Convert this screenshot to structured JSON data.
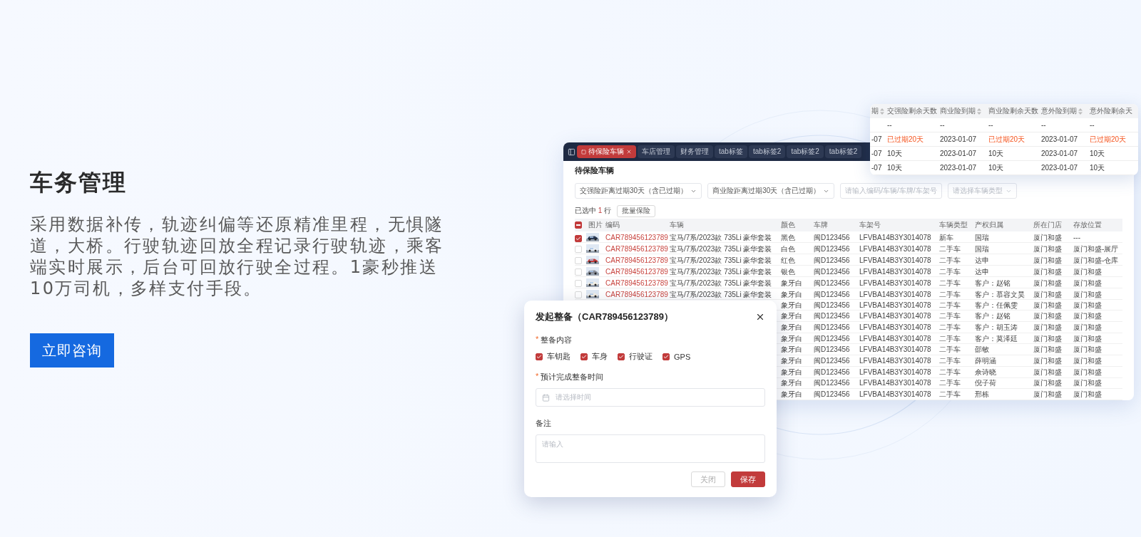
{
  "hero": {
    "title": "车务管理",
    "description": "采用数据补传，轨迹纠偏等还原精准里程，无惧隧道，大桥。行驶轨迹回放全程记录行驶轨迹，乘客端实时展示，后台可回放行驶全过程。1豪秒推送10万司机，多样支付手段。",
    "button": "立即咨询"
  },
  "app": {
    "tabs": [
      {
        "label": "待保险车辆",
        "selected": true
      },
      {
        "label": "车店管理",
        "selected": false
      },
      {
        "label": "财务管理",
        "selected": false
      },
      {
        "label": "tab标签",
        "selected": false
      },
      {
        "label": "tab标签2",
        "selected": false
      },
      {
        "label": "tab标签2",
        "selected": false
      },
      {
        "label": "tab标签2",
        "selected": false
      }
    ],
    "page_title": "待保险车辆",
    "filters": [
      {
        "kind": "select",
        "value": "交强险距离过期30天（含已过期）"
      },
      {
        "kind": "select",
        "value": "商业险距离过期30天（含已过期）"
      },
      {
        "kind": "input",
        "placeholder": "请输入编码/车辆/车牌/车架号"
      },
      {
        "kind": "select",
        "placeholder": "请选择车辆类型"
      }
    ],
    "selection": {
      "prefix": "已选中",
      "count": "1",
      "suffix": "行"
    },
    "batch_button": "批量保险",
    "table": {
      "select_all_partial": true,
      "columns": [
        "图片",
        "编码",
        "车辆",
        "颜色",
        "车牌",
        "车架号",
        "车辆类型",
        "产权归属",
        "所在门店",
        "存放位置"
      ],
      "rows": [
        {
          "checked": true,
          "code": "CAR789456123789",
          "vehicle": "宝马/7系/2023款 735Li 豪华套装",
          "paint": "黑色",
          "plate": "闽D123456",
          "vin": "LFVBA14B3Y3014078",
          "type": "新车",
          "owner": "国瑞",
          "store": "厦门和盛",
          "location": "---"
        },
        {
          "checked": false,
          "code": "CAR789456123789",
          "vehicle": "宝马/7系/2023款 735Li 豪华套装",
          "paint": "白色",
          "plate": "闽D123456",
          "vin": "LFVBA14B3Y3014078",
          "type": "二手车",
          "owner": "国瑞",
          "store": "厦门和盛",
          "location": "厦门和盛-展厅"
        },
        {
          "checked": false,
          "code": "CAR789456123789",
          "vehicle": "宝马/7系/2023款 735Li 豪华套装",
          "paint": "红色",
          "plate": "闽D123456",
          "vin": "LFVBA14B3Y3014078",
          "type": "二手车",
          "owner": "达申",
          "store": "厦门和盛",
          "location": "厦门和盛-仓库"
        },
        {
          "checked": false,
          "code": "CAR789456123789",
          "vehicle": "宝马/7系/2023款 735Li 豪华套装",
          "paint": "银色",
          "plate": "闽D123456",
          "vin": "LFVBA14B3Y3014078",
          "type": "二手车",
          "owner": "达申",
          "store": "厦门和盛",
          "location": "厦门和盛"
        },
        {
          "checked": false,
          "code": "CAR789456123789",
          "vehicle": "宝马/7系/2023款 735Li 豪华套装",
          "paint": "象牙白",
          "plate": "闽D123456",
          "vin": "LFVBA14B3Y3014078",
          "type": "二手车",
          "owner": "客户：赵铭",
          "store": "厦门和盛",
          "location": "厦门和盛"
        },
        {
          "checked": false,
          "code": "CAR789456123789",
          "vehicle": "宝马/7系/2023款 735Li 豪华套装",
          "paint": "象牙白",
          "plate": "闽D123456",
          "vin": "LFVBA14B3Y3014078",
          "type": "二手车",
          "owner": "客户：慕容文昊",
          "store": "厦门和盛",
          "location": "厦门和盛"
        },
        {
          "paint": "象牙白",
          "plate": "闽D123456",
          "vin": "LFVBA14B3Y3014078",
          "type": "二手车",
          "owner": "客户：任佩雯",
          "store": "厦门和盛",
          "location": "厦门和盛"
        },
        {
          "paint": "象牙白",
          "plate": "闽D123456",
          "vin": "LFVBA14B3Y3014078",
          "type": "二手车",
          "owner": "客户：赵铭",
          "store": "厦门和盛",
          "location": "厦门和盛"
        },
        {
          "paint": "象牙白",
          "plate": "闽D123456",
          "vin": "LFVBA14B3Y3014078",
          "type": "二手车",
          "owner": "客户：胡玉涛",
          "store": "厦门和盛",
          "location": "厦门和盛"
        },
        {
          "paint": "象牙白",
          "plate": "闽D123456",
          "vin": "LFVBA14B3Y3014078",
          "type": "二手车",
          "owner": "客户：莫泽廷",
          "store": "厦门和盛",
          "location": "厦门和盛"
        },
        {
          "paint": "象牙白",
          "plate": "闽D123456",
          "vin": "LFVBA14B3Y3014078",
          "type": "二手车",
          "owner": "邵敏",
          "store": "厦门和盛",
          "location": "厦门和盛"
        },
        {
          "paint": "象牙白",
          "plate": "闽D123456",
          "vin": "LFVBA14B3Y3014078",
          "type": "二手车",
          "owner": "薛明涵",
          "store": "厦门和盛",
          "location": "厦门和盛"
        },
        {
          "paint": "象牙白",
          "plate": "闽D123456",
          "vin": "LFVBA14B3Y3014078",
          "type": "二手车",
          "owner": "佘诗晓",
          "store": "厦门和盛",
          "location": "厦门和盛"
        },
        {
          "paint": "象牙白",
          "plate": "闽D123456",
          "vin": "LFVBA14B3Y3014078",
          "type": "二手车",
          "owner": "倪子荷",
          "store": "厦门和盛",
          "location": "厦门和盛"
        },
        {
          "paint": "象牙白",
          "plate": "闽D123456",
          "vin": "LFVBA14B3Y3014078",
          "type": "二手车",
          "owner": "邢栋",
          "store": "厦门和盛",
          "location": "厦门和盛"
        }
      ]
    }
  },
  "expiry_card": {
    "columns": [
      {
        "label": "期",
        "sortable": true
      },
      {
        "label": "交强险剩余天数"
      },
      {
        "label": "商业险到期",
        "sortable": true
      },
      {
        "label": "商业险剩余天数"
      },
      {
        "label": "意外险到期",
        "sortable": true
      },
      {
        "label": "意外险剩余天"
      }
    ],
    "rows": [
      {
        "cells": [
          {
            "text": ""
          },
          {
            "text": "--"
          },
          {
            "text": "--"
          },
          {
            "text": "--"
          },
          {
            "text": "--"
          },
          {
            "text": "--"
          }
        ]
      },
      {
        "cells": [
          {
            "text": "-07"
          },
          {
            "text": "已过期20天",
            "expired": true
          },
          {
            "text": "2023-01-07"
          },
          {
            "text": "已过期20天",
            "expired": true
          },
          {
            "text": "2023-01-07"
          },
          {
            "text": "已过期20天",
            "expired": true
          }
        ]
      },
      {
        "cells": [
          {
            "text": "-07"
          },
          {
            "text": "10天"
          },
          {
            "text": "2023-01-07"
          },
          {
            "text": "10天"
          },
          {
            "text": "2023-01-07"
          },
          {
            "text": "10天"
          }
        ]
      },
      {
        "cells": [
          {
            "text": "-07"
          },
          {
            "text": "10天"
          },
          {
            "text": "2023-01-07"
          },
          {
            "text": "10天"
          },
          {
            "text": "2023-01-07"
          },
          {
            "text": "10天"
          }
        ]
      }
    ]
  },
  "dialog": {
    "title": "发起整备（CAR789456123789）",
    "fields": [
      {
        "kind": "checkboxes",
        "marker": "*",
        "label": "整备内容",
        "options": [
          {
            "label": "车钥匙",
            "checked": true
          },
          {
            "label": "车身",
            "checked": true
          },
          {
            "label": "行驶证",
            "checked": true
          },
          {
            "label": "GPS",
            "checked": true
          }
        ]
      },
      {
        "kind": "date",
        "marker": "*",
        "label": "预计完成整备时间",
        "placeholder": "请选择时间"
      },
      {
        "kind": "textarea",
        "label": "备注",
        "placeholder": "请输入"
      }
    ],
    "buttons": [
      {
        "label": "关闭",
        "primary": false
      },
      {
        "label": "保存",
        "primary": true
      }
    ]
  }
}
